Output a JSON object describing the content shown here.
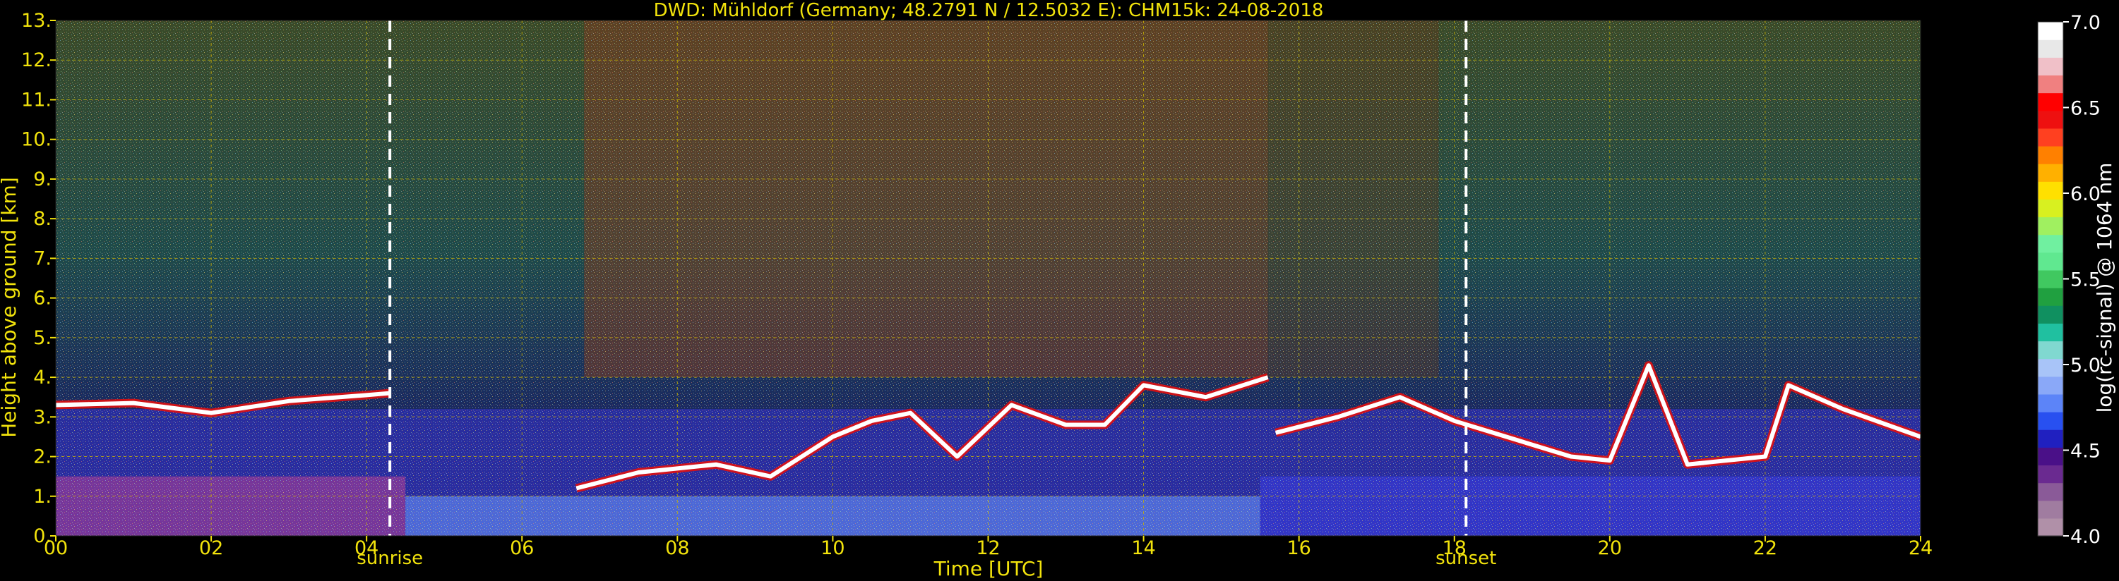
{
  "chart_data": {
    "type": "heatmap",
    "title": "DWD: Mühldorf (Germany; 48.2791 N / 12.5032 E):    CHM15k: 24-08-2018",
    "xlabel": "Time [UTC]",
    "ylabel": "Height above ground [km]",
    "xlim": [
      0,
      24
    ],
    "ylim": [
      0,
      13
    ],
    "x_ticks": [
      0,
      2,
      4,
      6,
      8,
      10,
      12,
      14,
      16,
      18,
      20,
      22,
      24
    ],
    "x_tick_labels": [
      "00",
      "02",
      "04",
      "06",
      "08",
      "10",
      "12",
      "14",
      "16",
      "18",
      "20",
      "22",
      "24"
    ],
    "y_ticks": [
      0,
      1,
      2,
      3,
      4,
      5,
      6,
      7,
      8,
      9,
      10,
      11,
      12,
      13
    ],
    "y_tick_labels": [
      "0.",
      "1.",
      "2.",
      "3.",
      "4.",
      "5.",
      "6.",
      "7.",
      "8.",
      "9.",
      "10.",
      "11.",
      "12.",
      "13."
    ],
    "grid": true,
    "annotations": [
      {
        "label": "sunrise",
        "x": 4.3
      },
      {
        "label": "sunset",
        "x": 18.15
      }
    ],
    "colorbar": {
      "label": "log(rc-signal) @ 1064 nm",
      "range": [
        4.0,
        7.0
      ],
      "ticks": [
        4.0,
        4.5,
        5.0,
        5.5,
        6.0,
        6.5,
        7.0
      ],
      "tick_labels": [
        "4.0",
        "4.5",
        "5.0",
        "5.5",
        "6.0",
        "6.5",
        "7.0"
      ],
      "colors": [
        "#b090a8",
        "#a07ca0",
        "#8a5a98",
        "#6a2a90",
        "#4a1088",
        "#2020c0",
        "#2850f0",
        "#5c84f8",
        "#8aa8f8",
        "#a8c4f8",
        "#80d8d0",
        "#20c0a0",
        "#109060",
        "#20a040",
        "#40c860",
        "#60e890",
        "#70f0a0",
        "#a0f060",
        "#d8f020",
        "#ffe000",
        "#ffb000",
        "#ff8000",
        "#ff4020",
        "#ee1010",
        "#ff0000",
        "#f08080",
        "#f0c0c8",
        "#e8e8e8",
        "#ffffff"
      ]
    },
    "layers": [
      {
        "name": "cloud base",
        "points": [
          [
            0.0,
            3.3
          ],
          [
            1.0,
            3.35
          ],
          [
            2.0,
            3.1
          ],
          [
            3.0,
            3.4
          ],
          [
            4.0,
            3.55
          ],
          [
            4.3,
            3.6
          ]
        ]
      },
      {
        "name": "cloud base",
        "points": [
          [
            6.7,
            1.2
          ],
          [
            7.5,
            1.6
          ],
          [
            8.5,
            1.8
          ],
          [
            9.2,
            1.5
          ],
          [
            10.0,
            2.5
          ],
          [
            10.5,
            2.9
          ],
          [
            11.0,
            3.1
          ],
          [
            11.6,
            2.0
          ],
          [
            12.3,
            3.3
          ],
          [
            13.0,
            2.8
          ],
          [
            13.5,
            2.8
          ],
          [
            14.0,
            3.8
          ],
          [
            14.8,
            3.5
          ],
          [
            15.6,
            4.0
          ]
        ]
      },
      {
        "name": "cloud base",
        "points": [
          [
            15.7,
            2.6
          ],
          [
            16.5,
            3.0
          ],
          [
            17.3,
            3.5
          ],
          [
            18.0,
            2.9
          ],
          [
            18.5,
            2.6
          ],
          [
            19.5,
            2.0
          ],
          [
            20.0,
            1.9
          ],
          [
            20.5,
            4.3
          ],
          [
            21.0,
            1.8
          ],
          [
            22.0,
            2.0
          ],
          [
            22.3,
            3.8
          ],
          [
            23.0,
            3.2
          ],
          [
            24.0,
            2.5
          ]
        ]
      }
    ]
  }
}
